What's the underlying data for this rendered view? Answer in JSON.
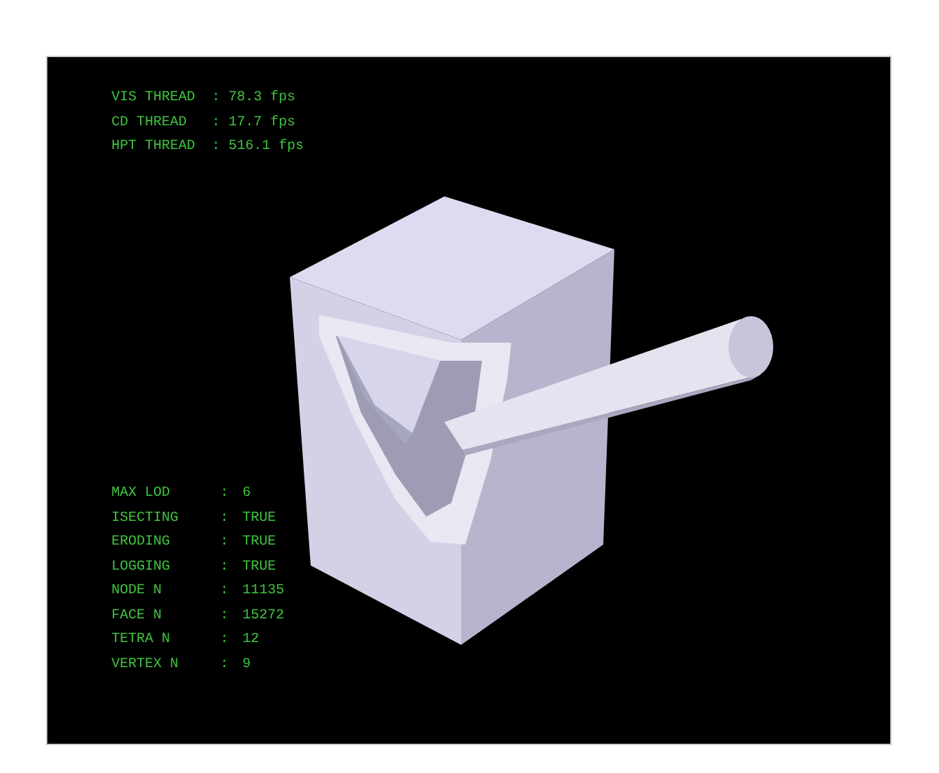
{
  "threads": [
    {
      "label": "VIS THREAD",
      "separator": ":",
      "value": "78.3 fps"
    },
    {
      "label": "CD THREAD",
      "separator": ":",
      "value": "17.7 fps"
    },
    {
      "label": "HPT THREAD",
      "separator": ":",
      "value": "516.1 fps"
    }
  ],
  "stats": [
    {
      "label": "MAX LOD",
      "separator": ":",
      "value": "6"
    },
    {
      "label": "ISECTING",
      "separator": ":",
      "value": "TRUE"
    },
    {
      "label": "ERODING",
      "separator": ":",
      "value": "TRUE"
    },
    {
      "label": "LOGGING",
      "separator": ":",
      "value": "TRUE"
    },
    {
      "label": "NODE N",
      "separator": ":",
      "value": "11135"
    },
    {
      "label": "FACE N",
      "separator": ":",
      "value": "15272"
    },
    {
      "label": "TETRA N",
      "separator": ":",
      "value": "12"
    },
    {
      "label": "VERTEX N",
      "separator": ":",
      "value": "9"
    }
  ]
}
